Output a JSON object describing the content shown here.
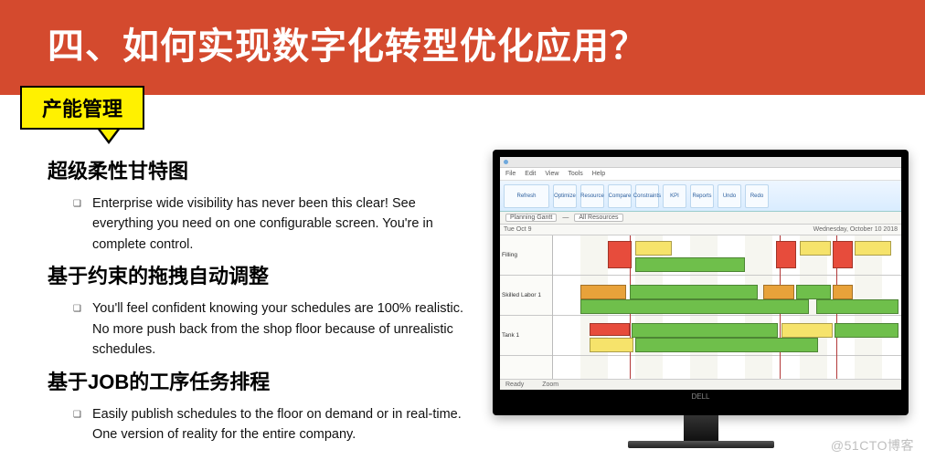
{
  "header": {
    "title": "四、如何实现数字化转型优化应用？"
  },
  "tag": {
    "label": "产能管理"
  },
  "sections": [
    {
      "heading": "超级柔性甘特图",
      "bullets": [
        "Enterprise wide visibility has never been this clear!  See everything you need on one configurable screen. You're in complete control."
      ]
    },
    {
      "heading": "基于约束的拖拽自动调整",
      "bullets": [
        "You'll feel confident knowing your schedules are 100% realistic.  No more push back from the shop floor because of unrealistic schedules."
      ]
    },
    {
      "heading": "基于JOB的工序任务排程",
      "bullets": [
        "Easily publish schedules to the floor on demand or in real-time.  One version of reality for the entire company."
      ]
    }
  ],
  "monitor": {
    "brand": "DELL",
    "app": {
      "menu": [
        "File",
        "Edit",
        "View",
        "Tools",
        "Help"
      ],
      "ribbon": [
        "Refresh",
        "Optimize",
        "Resource",
        "Compare",
        "Constraints",
        "KPI",
        "Reports",
        "Undo",
        "Redo"
      ],
      "toolbar2": [
        "Planning Gantt",
        "—",
        "All Resources"
      ],
      "datebar_left": "Tue Oct 9",
      "datebar_right": "Wednesday, October 10 2018",
      "rows": [
        "Filling",
        "Skilled Labor 1",
        "Tank 1"
      ],
      "footer": [
        "Ready",
        "Zoom"
      ]
    }
  },
  "watermark": "@51CTO博客"
}
